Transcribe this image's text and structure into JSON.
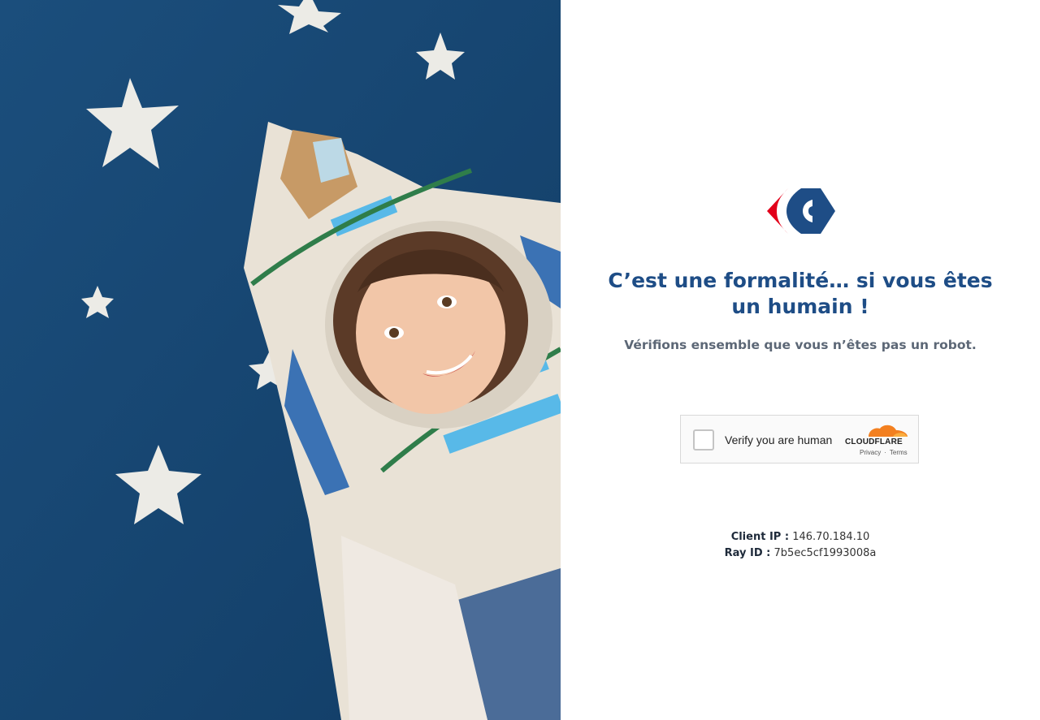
{
  "brand": {
    "logo_name": "carrefour-logo",
    "colors": {
      "red": "#e2001a",
      "blue": "#1e4d86"
    }
  },
  "hero": {
    "image_name": "child-in-cardboard-rocket-costume"
  },
  "main": {
    "title": "C’est une formalité… si vous êtes un humain !",
    "subtitle": "Vérifions ensemble que vous n’êtes pas un robot."
  },
  "challenge": {
    "label": "Verify you are human",
    "provider": "CLOUDFLARE",
    "privacy_link": "Privacy",
    "separator": "·",
    "terms_link": "Terms",
    "accent": "#f38020"
  },
  "meta": {
    "client_ip_label": "Client IP :",
    "client_ip_value": "146.70.184.10",
    "ray_id_label": "Ray ID :",
    "ray_id_value": "7b5ec5cf1993008a"
  }
}
